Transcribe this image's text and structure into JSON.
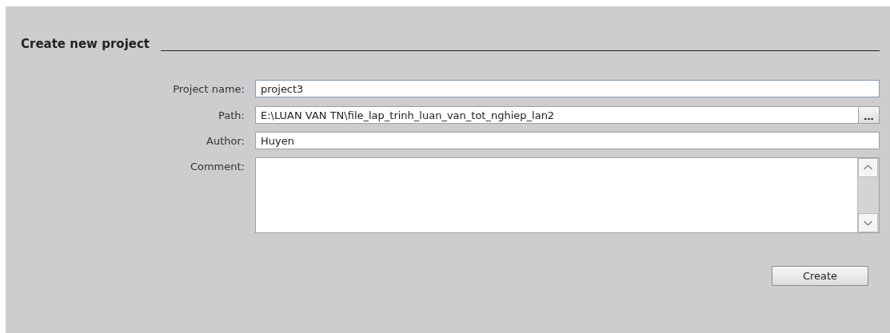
{
  "section": {
    "title": "Create new project"
  },
  "fields": [
    {
      "kind": "text",
      "label": "Project name:",
      "value": "project3",
      "focused": true
    },
    {
      "kind": "browse",
      "label": "Path:",
      "value": "E:\\LUAN VAN TN\\file_lap_trinh_luan_van_tot_nghiep_lan2",
      "focused": false,
      "button": "..."
    },
    {
      "kind": "text",
      "label": "Author:",
      "value": "Huyen",
      "focused": false
    },
    {
      "kind": "multiline",
      "label": "Comment:",
      "focused": false
    }
  ],
  "buttons": [
    "Create"
  ]
}
